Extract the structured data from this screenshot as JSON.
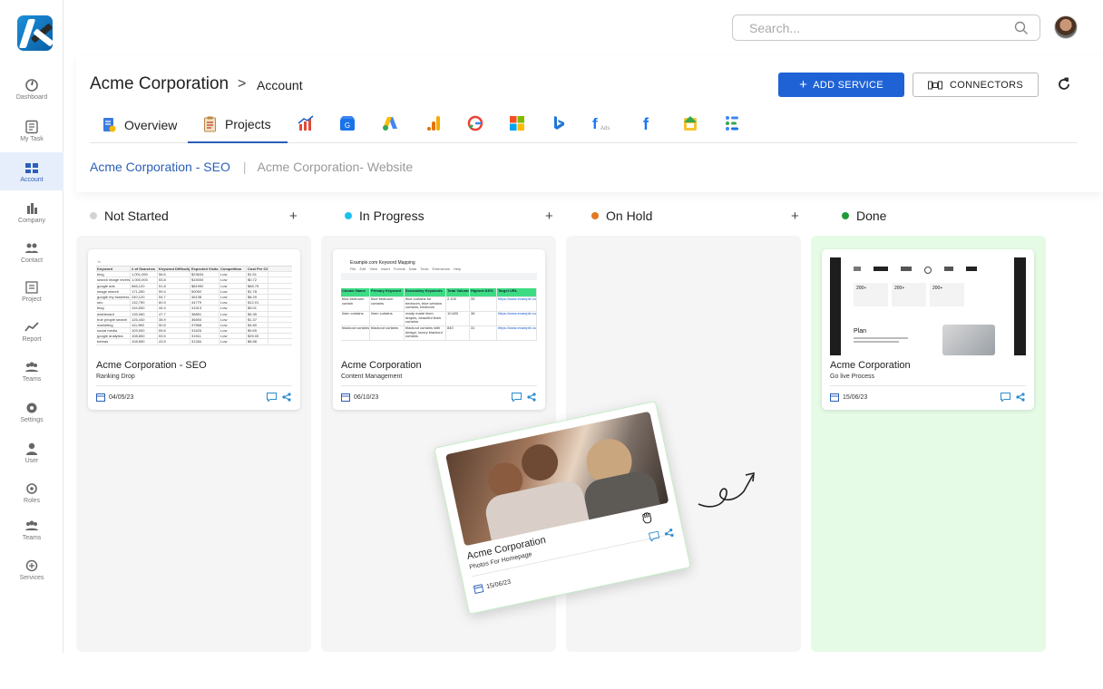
{
  "sidebar": {
    "items": [
      {
        "label": "Dashboard",
        "icon": "dashboard-icon"
      },
      {
        "label": "My Task",
        "icon": "task-icon"
      },
      {
        "label": "Account",
        "icon": "account-icon",
        "active": true
      },
      {
        "label": "Company",
        "icon": "company-icon"
      },
      {
        "label": "Contact",
        "icon": "contact-icon"
      },
      {
        "label": "Project",
        "icon": "project-icon"
      },
      {
        "label": "Report",
        "icon": "report-icon"
      },
      {
        "label": "Teams",
        "icon": "teams-icon"
      },
      {
        "label": "Settings",
        "icon": "settings-icon"
      },
      {
        "label": "User",
        "icon": "user-icon"
      },
      {
        "label": "Roles",
        "icon": "roles-icon"
      },
      {
        "label": "Teams",
        "icon": "teams-icon"
      },
      {
        "label": "Services",
        "icon": "services-icon"
      }
    ]
  },
  "search": {
    "placeholder": "Search..."
  },
  "header": {
    "breadcrumb": {
      "company": "Acme Corporation",
      "separator": ">",
      "page": "Account"
    },
    "add_service_label": "ADD SERVICE",
    "connectors_label": "CONNECTORS",
    "tabs": [
      {
        "label": "Overview",
        "icon": "overview-icon"
      },
      {
        "label": "Projects",
        "icon": "projects-icon",
        "active": true
      }
    ],
    "service_icons": [
      "analytics-icon",
      "google-my-business-icon",
      "google-ads-icon",
      "google-analytics-icon",
      "google-search-console-icon",
      "microsoft-icon",
      "bing-icon",
      "facebook-ads-icon",
      "facebook-icon",
      "google-sheets-icon",
      "google-data-studio-icon"
    ],
    "subtabs": [
      "Acme Corporation - SEO",
      "Acme Corporation- Website"
    ]
  },
  "columns": [
    {
      "title": "Not Started",
      "color": "#d3d3d3"
    },
    {
      "title": "In Progress",
      "color": "#1ec0ee"
    },
    {
      "title": "On Hold",
      "color": "#e07a20"
    },
    {
      "title": "Done",
      "color": "#1f9a3a"
    }
  ],
  "cards": [
    {
      "title": "Acme Corporation - SEO",
      "subtitle": "Ranking Drop",
      "date": "04/05/23"
    },
    {
      "title": "Acme Corporation",
      "subtitle": "Content Management",
      "date": "06/10/23"
    },
    {
      "title": "Acme Corporation",
      "subtitle": "Go live Process",
      "date": "15/06/23"
    }
  ],
  "floating_card": {
    "title": "Acme Corporation",
    "subtitle": "Photos For Homepage",
    "date": "15/06/23"
  },
  "spreadsheet": {
    "headers": [
      "Keyword",
      "# of Searches",
      "Keyword Difficulty",
      "Expected Visits",
      "Competition",
      "Cost Per Click"
    ],
    "rows": [
      [
        "blog",
        "1,001,050",
        "56.6",
        "$23634",
        "Low",
        "$1.51"
      ],
      [
        "search image reverse",
        "1,000,000",
        "53.8",
        "$15000",
        "Low",
        "$0.72"
      ],
      [
        "google ads",
        "566,120",
        "51.8",
        "$81992",
        "Low",
        "$65.75"
      ],
      [
        "image search",
        "171,260",
        "59.4",
        "50092",
        "Low",
        "$1.78"
      ],
      [
        "google my business",
        "240,120",
        "54.7",
        "46138",
        "Low",
        "$8.29"
      ],
      [
        "seo",
        "132,790",
        "60.9",
        "44779",
        "Low",
        "$12.01"
      ],
      [
        "blog",
        "134,500",
        "44.4",
        "41513",
        "Low",
        "$5.01"
      ],
      [
        "dashboard",
        "135,060",
        "47.7",
        "38851",
        "Low",
        "$5.35"
      ],
      [
        "true people search",
        "126,440",
        "38.9",
        "36693",
        "Low",
        "$1.37"
      ],
      [
        "marketing",
        "111,980",
        "50.6",
        "37568",
        "Low",
        "$4.80"
      ],
      [
        "social media",
        "109,000",
        "59.6",
        "31625",
        "Low",
        "$9.69"
      ],
      [
        "google analytics",
        "108,650",
        "53.5",
        "31511",
        "Low",
        "$25.00"
      ],
      [
        "bebras",
        "108,550",
        "43.5",
        "31284",
        "Low",
        "$8.58"
      ]
    ]
  },
  "keyword_sheet": {
    "title": "Example.com Keyword Mapping",
    "menu": [
      "File",
      "Edit",
      "View",
      "Insert",
      "Format",
      "Data",
      "Tools",
      "Extensions",
      "Help"
    ],
    "headers": [
      "Cluster Name",
      "Primary Keyword",
      "Secondary Keywords",
      "Total Volume",
      "Highest KD%",
      "Target URL"
    ],
    "rows": [
      [
        "blue bedroom curtain",
        "blue bedroom curtains",
        "blue curtains for bedroom, blue window curtains, bedroom curtains blue",
        "2,100",
        "26",
        "https://www.example.com/curtains/blue"
      ],
      [
        "linen curtains",
        "linen curtains",
        "ready made linen drapes, beautiful linen curtains",
        "10,600",
        "36",
        "https://www.example.com/curtains/linen"
      ],
      [
        "blackout curtains",
        "blackout curtains",
        "blackout curtains with design, luxury blackout curtains",
        "840",
        "31",
        "https://www.example.com/bedroom/blackout"
      ]
    ]
  },
  "website_preview": {
    "heading": "Plan",
    "stats": [
      "200+",
      "200+",
      "200+"
    ]
  }
}
